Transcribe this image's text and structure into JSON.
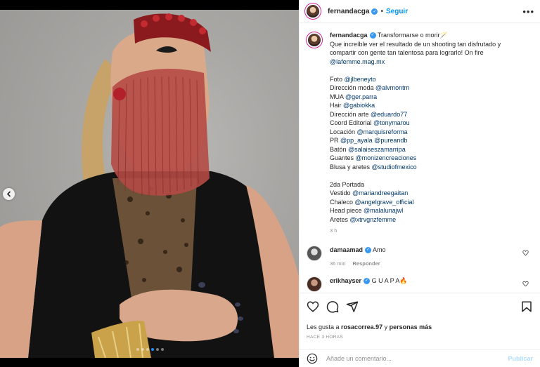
{
  "post": {
    "username": "fernandacga",
    "follow_label": "Seguir",
    "dot": "•",
    "more_icon": "more-horizontal-icon"
  },
  "caption": {
    "username": "fernandacga",
    "lines": [
      {
        "text": "Transformarse o morir🪄",
        "mention": ""
      },
      {
        "text": "Que increíble ver el resultado de un shooting tan disfrutado y",
        "mention": ""
      },
      {
        "text": "compartir con gente tan talentosa para lograrlo! On fire",
        "mention": ""
      },
      {
        "text": "",
        "mention": "@lafemme.mag.mx"
      },
      {
        "text": "",
        "mention": ""
      },
      {
        "text": "Foto ",
        "mention": "@jlbeneyto"
      },
      {
        "text": "Dirección moda ",
        "mention": "@alvmontm"
      },
      {
        "text": "MUA ",
        "mention": "@ger.parra"
      },
      {
        "text": "Hair ",
        "mention": "@gabiokka"
      },
      {
        "text": "Dirección arte ",
        "mention": "@eduardo77"
      },
      {
        "text": "Coord Editorial ",
        "mention": "@tonymarou"
      },
      {
        "text": "Locación ",
        "mention": "@marquisreforma"
      },
      {
        "text": "PR ",
        "mention": "@pp_ayala @pureandb"
      },
      {
        "text": "Batón ",
        "mention": "@salaiseszamarripa"
      },
      {
        "text": "Guantes ",
        "mention": "@monizencreaciones"
      },
      {
        "text": "Blusa y aretes ",
        "mention": "@studiofmexico"
      },
      {
        "text": "",
        "mention": ""
      },
      {
        "text": "2da Portada",
        "mention": ""
      },
      {
        "text": "Vestido ",
        "mention": "@mariandreegaitan"
      },
      {
        "text": "Chaleco ",
        "mention": "@angelgrave_official"
      },
      {
        "text": "Head piece ",
        "mention": "@malalunajwl"
      },
      {
        "text": "Aretes ",
        "mention": "@xtrvgnzfemme"
      }
    ],
    "time": "3 h"
  },
  "comments": [
    {
      "username": "damaamad",
      "verified": true,
      "text": "Amo",
      "time": "36 min",
      "reply": "Responder"
    },
    {
      "username": "erikhayser",
      "verified": true,
      "text": "G U A P A🔥",
      "time": "",
      "reply": ""
    }
  ],
  "actions": {
    "like_icon": "heart-icon",
    "comment_icon": "comment-icon",
    "share_icon": "send-icon",
    "save_icon": "bookmark-icon"
  },
  "likes": {
    "prefix": "Les gusta a ",
    "user": "rosacorrea.97",
    "middle": " y ",
    "others": "personas más"
  },
  "ago": "HACE 3 HORAS",
  "add_comment": {
    "placeholder": "Añade un comentario...",
    "publish": "Publicar"
  },
  "carousel": {
    "count": 6,
    "active": 4
  },
  "colors": {
    "link": "#0095f6",
    "mention": "#00376b",
    "verified": "#3897f0",
    "muted": "#8e8e8e"
  }
}
